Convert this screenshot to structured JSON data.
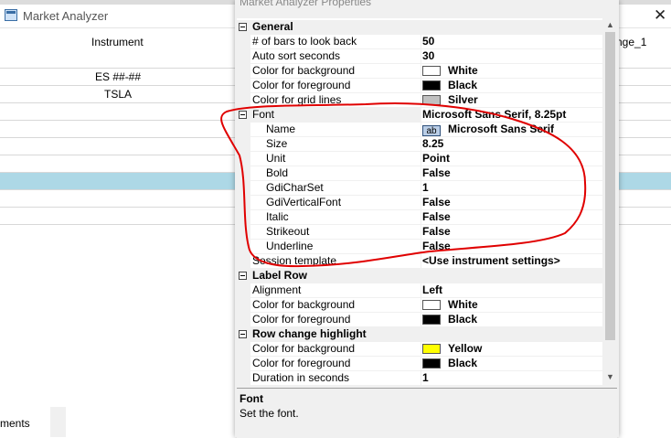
{
  "market_analyzer": {
    "title": "Market Analyzer",
    "columns": {
      "instrument": "Instrument",
      "change": "nge_1"
    },
    "rows": [
      {
        "instrument": "ES ##-##"
      },
      {
        "instrument": "TSLA"
      }
    ],
    "bottom_tab_label": "ments"
  },
  "dialog": {
    "title": "Market Analyzer Properties",
    "categories": {
      "general": "General",
      "label_row": "Label Row",
      "row_change": "Row change highlight"
    },
    "properties": {
      "bars_look_back": {
        "name": "# of bars to look back",
        "value": "50"
      },
      "auto_sort": {
        "name": "Auto sort seconds",
        "value": "30"
      },
      "bg_color": {
        "name": "Color for background",
        "value": "White",
        "swatch": "#ffffff"
      },
      "fg_color": {
        "name": "Color for foreground",
        "value": "Black",
        "swatch": "#000000"
      },
      "grid_color": {
        "name": "Color for grid lines",
        "value": "Silver",
        "swatch": "#c0c0c0"
      },
      "font": {
        "name": "Font",
        "value": "Microsoft Sans Serif, 8.25pt"
      },
      "font_name": {
        "name": "Name",
        "badge": "ab",
        "value": "Microsoft Sans Serif"
      },
      "font_size": {
        "name": "Size",
        "value": "8.25"
      },
      "font_unit": {
        "name": "Unit",
        "value": "Point"
      },
      "font_bold": {
        "name": "Bold",
        "value": "False"
      },
      "gdi_charset": {
        "name": "GdiCharSet",
        "value": "1"
      },
      "gdi_vertical": {
        "name": "GdiVerticalFont",
        "value": "False"
      },
      "font_italic": {
        "name": "Italic",
        "value": "False"
      },
      "font_strikeout": {
        "name": "Strikeout",
        "value": "False"
      },
      "font_underline": {
        "name": "Underline",
        "value": "False"
      },
      "session_template": {
        "name": "Session template",
        "value": "<Use instrument settings>"
      },
      "alignment": {
        "name": "Alignment",
        "value": "Left"
      },
      "lr_bg": {
        "name": "Color for background",
        "value": "White",
        "swatch": "#ffffff"
      },
      "lr_fg": {
        "name": "Color for foreground",
        "value": "Black",
        "swatch": "#000000"
      },
      "rc_bg": {
        "name": "Color for background",
        "value": "Yellow",
        "swatch": "#ffff00"
      },
      "rc_fg": {
        "name": "Color for foreground",
        "value": "Black",
        "swatch": "#000000"
      },
      "duration": {
        "name": "Duration in seconds",
        "value": "1"
      }
    },
    "help": {
      "title": "Font",
      "description": "Set the font."
    }
  },
  "colors": {
    "selected_row": "#add8e6",
    "annotation": "#e00000"
  },
  "icons": [
    "window-icon",
    "close-icon",
    "collapse-toggle-icon",
    "scroll-up-icon",
    "scroll-down-icon"
  ]
}
